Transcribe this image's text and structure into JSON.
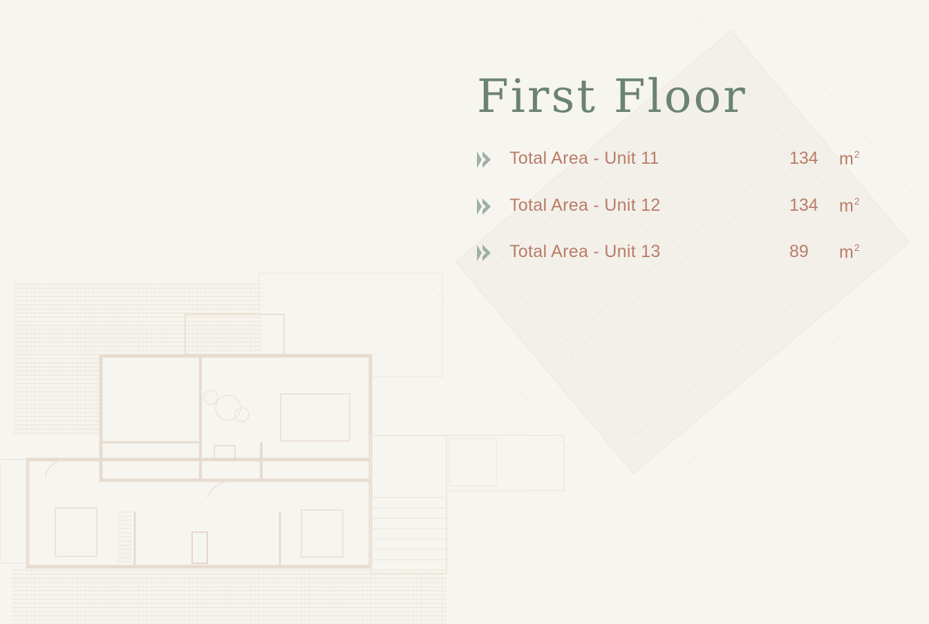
{
  "page": {
    "title": "First Floor"
  },
  "areas": [
    {
      "label": "Total Area - Unit 11",
      "value": "134",
      "unit": "m",
      "unit_power": "2"
    },
    {
      "label": "Total Area - Unit 12",
      "value": "134",
      "unit": "m",
      "unit_power": "2"
    },
    {
      "label": "Total Area - Unit 13",
      "value": "89",
      "unit": "m",
      "unit_power": "2"
    }
  ],
  "icons": {
    "row_marker": "chevron-right-icon"
  },
  "colors": {
    "background": "#f7f5f0",
    "title": "#6b8275",
    "text_accent": "#b97c66",
    "icon": "#9fb0a6",
    "plan_lines": "#e9dfd3"
  }
}
